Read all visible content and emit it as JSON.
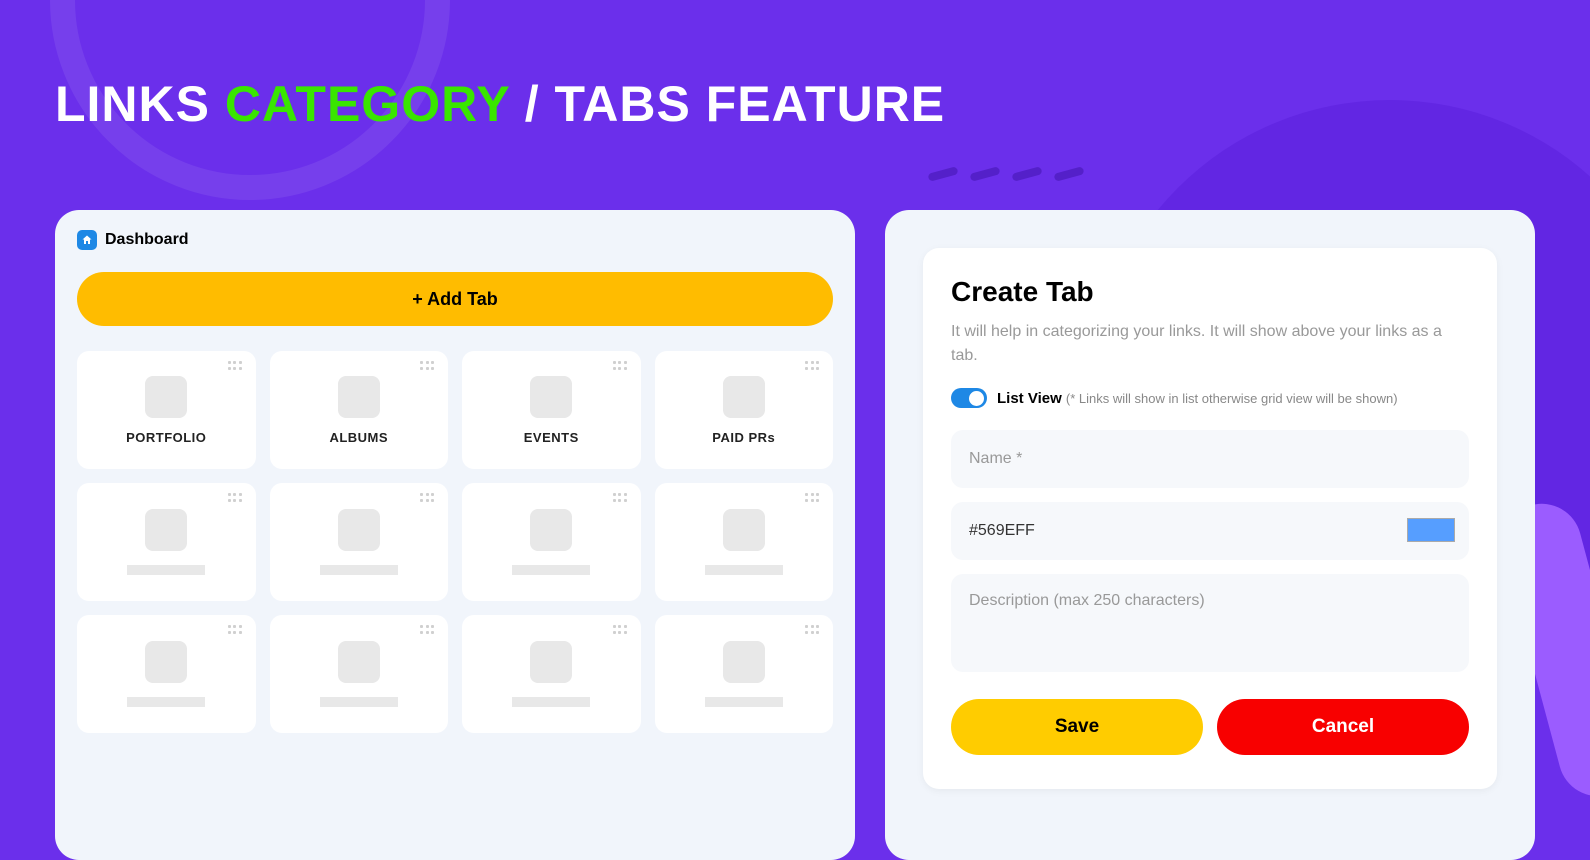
{
  "hero": {
    "part1": "LINKS ",
    "part2": "CATEGORY",
    "part3": " / TABS FEATURE"
  },
  "left_panel": {
    "breadcrumb": "Dashboard",
    "add_tab_button": "+ Add Tab",
    "tabs": [
      {
        "label": "PORTFOLIO"
      },
      {
        "label": "ALBUMS"
      },
      {
        "label": "EVENTS"
      },
      {
        "label": "PAID PRs"
      }
    ]
  },
  "right_panel": {
    "title": "Create Tab",
    "description": "It will help in categorizing your links. It will show above your links as a tab.",
    "toggle_label": "List View ",
    "toggle_note": "(* Links will show in list otherwise grid view will be shown)",
    "name_placeholder": "Name *",
    "color_value": "#569EFF",
    "color_hex": "#569EFF",
    "desc_placeholder": "Description (max 250 characters)",
    "save_label": "Save",
    "cancel_label": "Cancel"
  }
}
